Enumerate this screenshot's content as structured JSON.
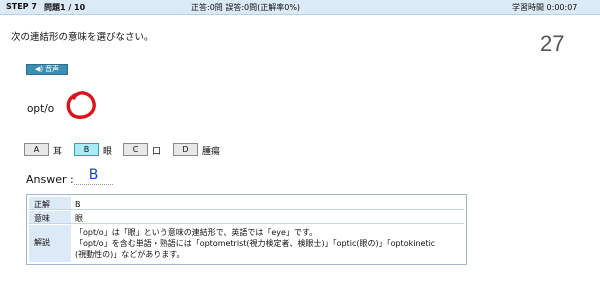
{
  "header": {
    "step": "STEP 7",
    "question_number": "問題1 / 10",
    "score": "正答:0問  誤答:0問(正解率0%)",
    "study_time": "学習時間  0:00:07"
  },
  "question": {
    "instruction": "次の連結形の意味を選びなさい。",
    "counter": "27",
    "audio_label": "音声",
    "word": "opt/o",
    "result_mark": "correct"
  },
  "choices": [
    {
      "key": "A",
      "text": "耳",
      "selected": false
    },
    {
      "key": "B",
      "text": "眼",
      "selected": true
    },
    {
      "key": "C",
      "text": "口",
      "selected": false
    },
    {
      "key": "D",
      "text": "腫瘍",
      "selected": false
    }
  ],
  "answer": {
    "label": "Answer :",
    "value": "B"
  },
  "result": {
    "correct_label": "正解",
    "correct_value": "B",
    "meaning_label": "意味",
    "meaning_value": "眼",
    "explanation_label": "解説",
    "explanation_lines": [
      "「opt/o」は「眼」という意味の連結形で、英語では「eye」です。",
      "「opt/o」を含む単語・熟語には「optometrist(視力検定者、検眼士)」「optic(眼の)」「optokinetic",
      "(視動性の)」などがあります。"
    ]
  },
  "colors": {
    "topbar": "#dbeaf7",
    "selected_choice": "#a8ecf7",
    "answer_text": "#1f3fd0",
    "correct_mark": "#d8141c",
    "label_cell": "#dce9f6"
  }
}
